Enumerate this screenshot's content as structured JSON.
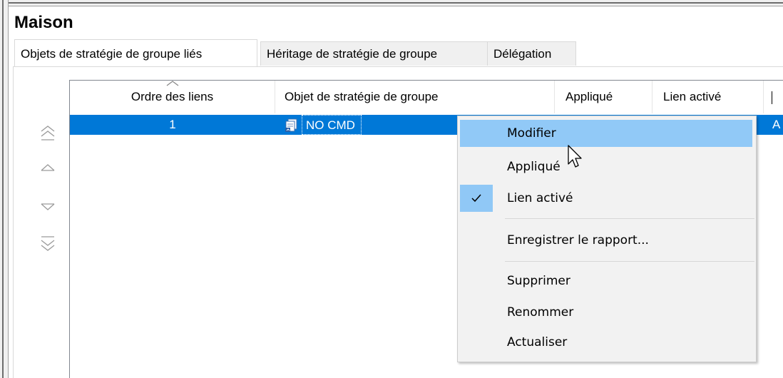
{
  "window": {
    "title": "Maison"
  },
  "tabs": [
    {
      "label": "Objets de stratégie de groupe liés",
      "active": true
    },
    {
      "label": "Héritage de stratégie de groupe",
      "active": false
    },
    {
      "label": "Délégation",
      "active": false
    }
  ],
  "reorder_buttons": [
    {
      "icon": "move-to-top-icon"
    },
    {
      "icon": "move-up-icon"
    },
    {
      "icon": "move-down-icon"
    },
    {
      "icon": "move-to-bottom-icon"
    }
  ],
  "table": {
    "columns": [
      "Ordre des liens",
      "Objet de stratégie de groupe",
      "Appliqué",
      "Lien activé",
      ""
    ],
    "rows": [
      {
        "order": "1",
        "gpo": "NO CMD",
        "enforced": "",
        "enabled": ""
      }
    ]
  },
  "context_menu": {
    "items": [
      {
        "label": "Modifier",
        "hover": true
      },
      {
        "label": "Appliqué"
      },
      {
        "label": "Lien activé",
        "checked": true
      },
      {
        "label": "Enregistrer le rapport..."
      },
      {
        "label": "Supprimer"
      },
      {
        "label": "Renommer"
      },
      {
        "label": "Actualiser"
      }
    ]
  },
  "colors": {
    "selection": "#0078d7",
    "menu_hover": "#91c9f7",
    "menu_bg": "#f2f2f2"
  }
}
